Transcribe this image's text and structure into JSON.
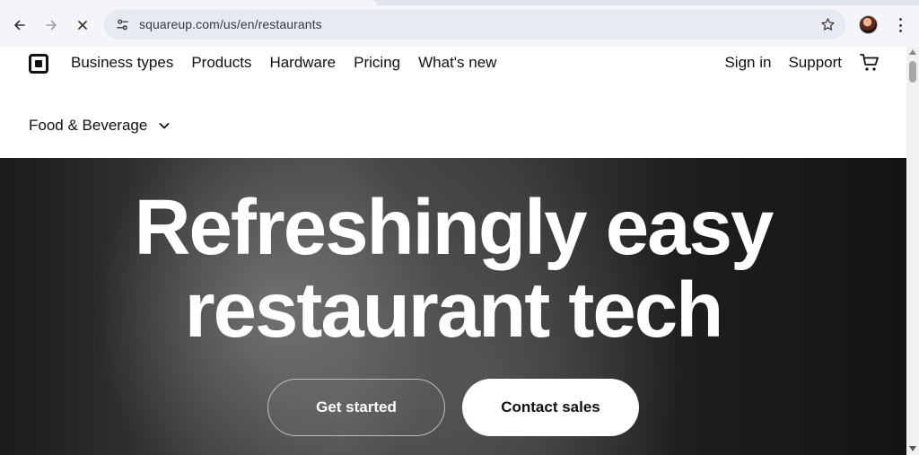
{
  "browser": {
    "url": "squareup.com/us/en/restaurants"
  },
  "header": {
    "nav_items": [
      "Business types",
      "Products",
      "Hardware",
      "Pricing",
      "What's new"
    ],
    "sign_in": "Sign in",
    "support": "Support"
  },
  "subnav": {
    "label": "Food & Beverage"
  },
  "hero": {
    "headline_line1": "Refreshingly easy",
    "headline_line2": "restaurant tech",
    "primary_cta": "Get started",
    "secondary_cta": "Contact sales"
  },
  "colors": {
    "chrome_bg": "#f3f5f9",
    "omnibox_bg": "#e7eaf1",
    "hero_dark": "#1b1b1b",
    "text": "#111111"
  },
  "icons": {
    "back": "arrow-left-icon",
    "forward": "arrow-right-icon",
    "stop": "close-icon",
    "site_info": "tune-icon",
    "bookmark": "star-icon",
    "cart": "cart-icon",
    "dropdown": "chevron-down-icon"
  }
}
